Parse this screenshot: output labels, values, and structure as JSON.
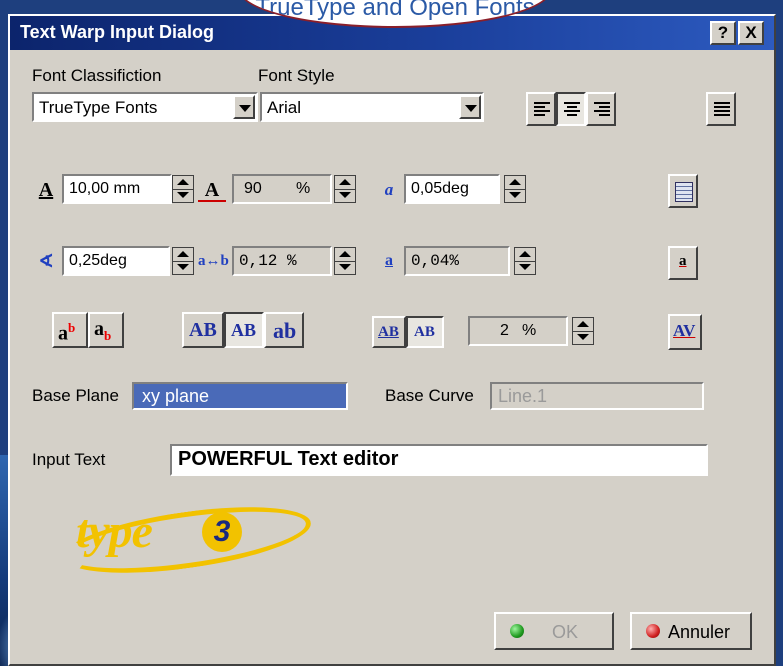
{
  "callout": {
    "text": "TrueType and Open Fonts"
  },
  "dialog": {
    "title": "Text Warp Input Dialog",
    "help_label": "?",
    "close_label": "X"
  },
  "font_classification": {
    "label": "Font Classifiction",
    "value": "TrueType Fonts"
  },
  "font_style": {
    "label": "Font Style",
    "value": "Arial"
  },
  "row1": {
    "height": "10,00 mm",
    "ratio": {
      "value": "90",
      "unit": "%"
    },
    "slant": "0,05deg"
  },
  "row2": {
    "rotation": "0,25deg",
    "spacing": "0,12 %",
    "char_width": "0,04%"
  },
  "styles": {
    "superscript_icon": "aᵇ",
    "subscript_icon": "aₕ",
    "upper_label": "AB",
    "small_caps_label": "AB",
    "lower_label": "ab",
    "case_a_label": "AB",
    "case_b_label": "AB",
    "percent": {
      "value": "2",
      "unit": "%"
    },
    "kerning_label": "AV",
    "underline_label": "a"
  },
  "base_plane": {
    "label": "Base Plane",
    "value": "xy plane"
  },
  "base_curve": {
    "label": "Base Curve",
    "value": "Line.1"
  },
  "input_text": {
    "label": "Input Text",
    "value": "POWERFUL Text editor"
  },
  "logo": {
    "text": "type",
    "badge": "3"
  },
  "buttons": {
    "ok": "OK",
    "cancel": "Annuler"
  },
  "colors": {
    "title_bar": "#0c246c",
    "selection": "#4a6ab8",
    "ok_dot": "#2aa52a",
    "cancel_dot": "#d02020",
    "logo_yellow": "#f4c400"
  }
}
